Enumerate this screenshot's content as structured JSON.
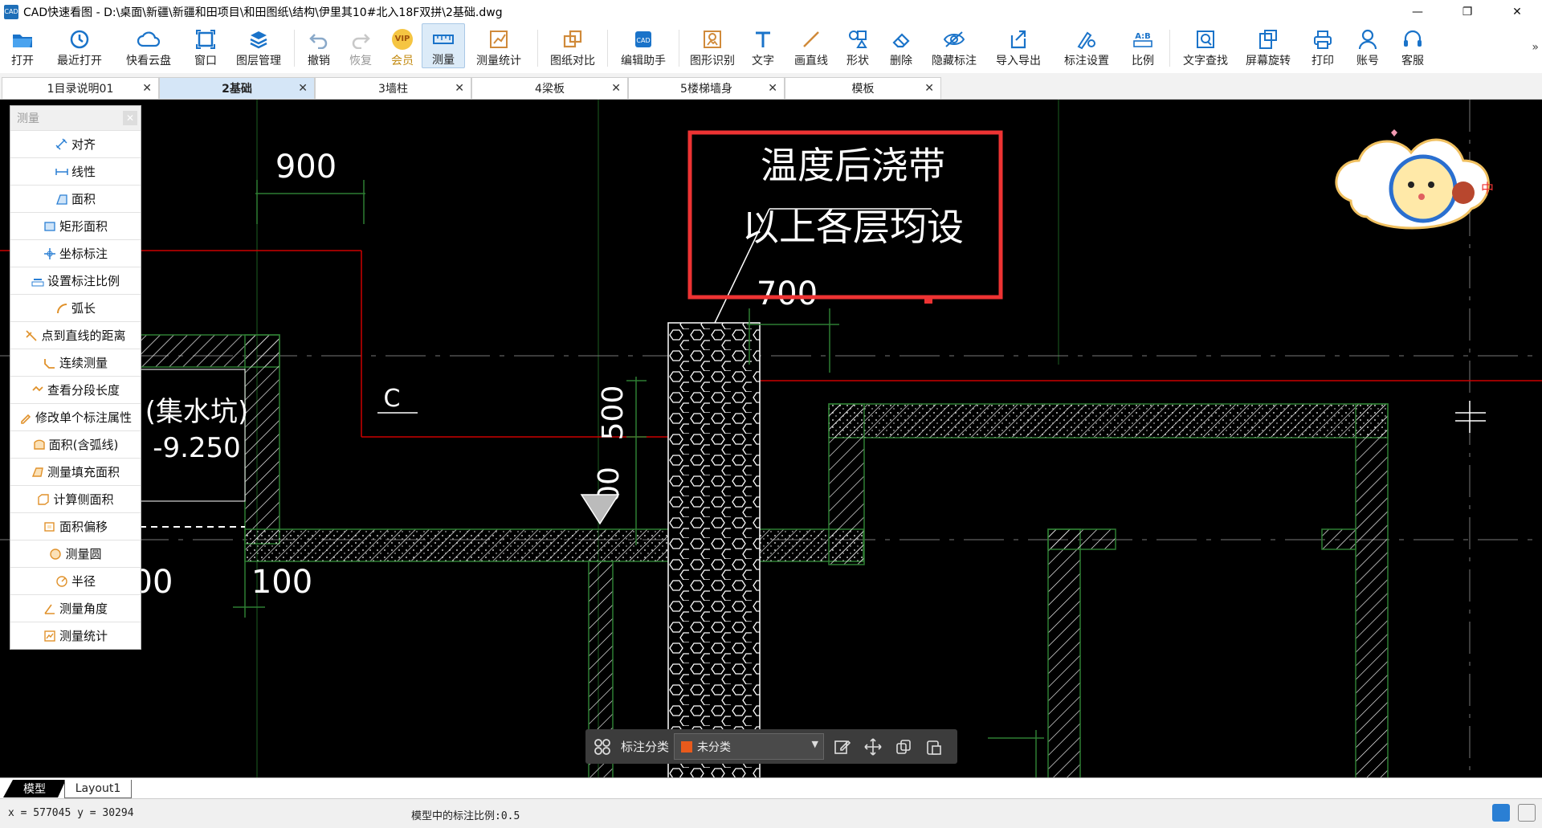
{
  "window": {
    "app_icon_text": "CAD",
    "title": "CAD快速看图 - D:\\桌面\\新疆\\新疆和田项目\\和田图纸\\结构\\伊里其10#北入18F双拼\\2基础.dwg",
    "minimize": "—",
    "restore": "❐",
    "close": "✕"
  },
  "toolbar": {
    "items": [
      {
        "label": "打开",
        "icon": "folder-open-icon"
      },
      {
        "label": "最近打开",
        "icon": "history-icon"
      },
      {
        "label": "快看云盘",
        "icon": "cloud-icon"
      },
      {
        "label": "窗口",
        "icon": "window-icon"
      },
      {
        "label": "图层管理",
        "icon": "layers-icon"
      },
      {
        "label": "撤销",
        "icon": "undo-icon"
      },
      {
        "label": "恢复",
        "icon": "redo-icon"
      },
      {
        "label": "会员",
        "icon": "vip-icon"
      },
      {
        "label": "测量",
        "icon": "measure-icon"
      },
      {
        "label": "测量统计",
        "icon": "measure-stats-icon"
      },
      {
        "label": "图纸对比",
        "icon": "compare-icon"
      },
      {
        "label": "编辑助手",
        "icon": "edit-assistant-icon"
      },
      {
        "label": "图形识别",
        "icon": "shape-recognize-icon"
      },
      {
        "label": "文字",
        "icon": "text-icon"
      },
      {
        "label": "画直线",
        "icon": "line-icon"
      },
      {
        "label": "形状",
        "icon": "shapes-icon"
      },
      {
        "label": "删除",
        "icon": "eraser-icon"
      },
      {
        "label": "隐藏标注",
        "icon": "hide-annotation-icon"
      },
      {
        "label": "导入导出",
        "icon": "import-export-icon"
      },
      {
        "label": "标注设置",
        "icon": "annotation-settings-icon"
      },
      {
        "label": "比例",
        "icon": "scale-icon"
      },
      {
        "label": "文字查找",
        "icon": "text-search-icon"
      },
      {
        "label": "屏幕旋转",
        "icon": "rotate-screen-icon"
      },
      {
        "label": "打印",
        "icon": "print-icon"
      },
      {
        "label": "账号",
        "icon": "account-icon"
      },
      {
        "label": "客服",
        "icon": "support-icon"
      }
    ],
    "vip_badge": "VIP",
    "more": "»"
  },
  "tabs": [
    {
      "label": "1目录说明01"
    },
    {
      "label": "2基础"
    },
    {
      "label": "3墙柱"
    },
    {
      "label": "4梁板"
    },
    {
      "label": "5楼梯墙身"
    },
    {
      "label": "模板"
    }
  ],
  "tab_close": "✕",
  "measure_panel": {
    "title": "测量",
    "close": "✕",
    "items": [
      "对齐",
      "线性",
      "面积",
      "矩形面积",
      "坐标标注",
      "设置标注比例",
      "弧长",
      "点到直线的距离",
      "连续测量",
      "查看分段长度",
      "修改单个标注属性",
      "面积(含弧线)",
      "测量填充面积",
      "计算侧面积",
      "面积偏移",
      "测量圆",
      "半径",
      "测量角度",
      "测量统计"
    ]
  },
  "drawing": {
    "dim_900": "900",
    "note_line1": "温度后浇带",
    "note_line2": "以上各层均设",
    "dim_700": "700",
    "label_c": "C",
    "pit_name": "(集水坑)",
    "pit_level": "-9.250",
    "dim_500": "500",
    "dim_100": "100",
    "dim_left_00": "00",
    "dim_vertical_00": "00",
    "mascot_text": "中"
  },
  "annotation_bar": {
    "label": "标注分类",
    "selected": "未分类",
    "swatch_color": "#e85a1c"
  },
  "layout_tabs": [
    "模型",
    "Layout1"
  ],
  "status": {
    "coords": "x = 577045  y = 30294",
    "scale_text": "模型中的标注比例:0.5"
  }
}
